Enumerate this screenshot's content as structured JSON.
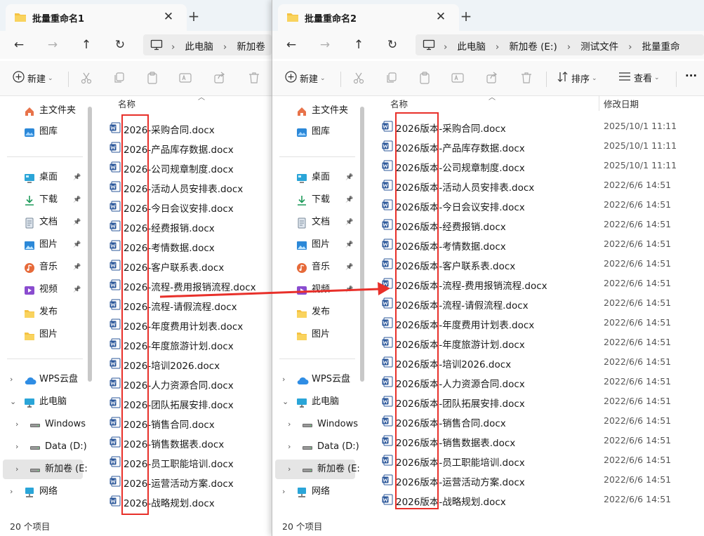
{
  "colors": {
    "accent": "#0067c0",
    "word_blue": "#2b579a",
    "highlight_red": "#e8302a",
    "folder_yellow": "#f5c242"
  },
  "window1": {
    "tab_title": "批量重命名1",
    "new_tab_label": "+",
    "breadcrumb": [
      "此电脑",
      "新加卷"
    ],
    "commands": {
      "new_label": "新建"
    },
    "sidebar": {
      "quick": [
        {
          "label": "主文件夹",
          "icon": "home-icon"
        },
        {
          "label": "图库",
          "icon": "gallery-icon"
        }
      ],
      "pinned": [
        {
          "label": "桌面",
          "icon": "desktop-icon"
        },
        {
          "label": "下载",
          "icon": "download-icon"
        },
        {
          "label": "文档",
          "icon": "document-icon"
        },
        {
          "label": "图片",
          "icon": "pictures-icon"
        },
        {
          "label": "音乐",
          "icon": "music-icon"
        },
        {
          "label": "视频",
          "icon": "video-icon"
        },
        {
          "label": "发布",
          "icon": "folder-icon"
        },
        {
          "label": "图片",
          "icon": "folder-icon"
        }
      ],
      "tree": [
        {
          "label": "WPS云盘",
          "icon": "cloud-icon"
        },
        {
          "label": "此电脑",
          "icon": "computer-icon"
        },
        {
          "label": "Windows",
          "icon": "drive-icon"
        },
        {
          "label": "Data (D:)",
          "icon": "drive-icon"
        },
        {
          "label": "新加卷 (E:",
          "icon": "drive-icon"
        },
        {
          "label": "网络",
          "icon": "network-icon"
        }
      ]
    },
    "column_name": "名称",
    "files": [
      "2026-采购合同.docx",
      "2026-产品库存数据.docx",
      "2026-公司规章制度.docx",
      "2026-活动人员安排表.docx",
      "2026-今日会议安排.docx",
      "2026-经费报销.docx",
      "2026-考情数据.docx",
      "2026-客户联系表.docx",
      "2026-流程-费用报销流程.docx",
      "2026-流程-请假流程.docx",
      "2026-年度费用计划表.docx",
      "2026-年度旅游计划.docx",
      "2026-培训2026.docx",
      "2026-人力资源合同.docx",
      "2026-团队拓展安排.docx",
      "2026-销售合同.docx",
      "2026-销售数据表.docx",
      "2026-员工职能培训.docx",
      "2026-运营活动方案.docx",
      "2026-战略规划.docx"
    ],
    "status": "20 个项目"
  },
  "window2": {
    "tab_title": "批量重命名2",
    "new_tab_label": "+",
    "breadcrumb": [
      "此电脑",
      "新加卷 (E:)",
      "测试文件",
      "批量重命"
    ],
    "commands": {
      "new_label": "新建",
      "sort_label": "排序",
      "view_label": "查看",
      "more_label": "···"
    },
    "sidebar": {
      "quick": [
        {
          "label": "主文件夹",
          "icon": "home-icon"
        },
        {
          "label": "图库",
          "icon": "gallery-icon"
        }
      ],
      "pinned": [
        {
          "label": "桌面",
          "icon": "desktop-icon"
        },
        {
          "label": "下载",
          "icon": "download-icon"
        },
        {
          "label": "文档",
          "icon": "document-icon"
        },
        {
          "label": "图片",
          "icon": "pictures-icon"
        },
        {
          "label": "音乐",
          "icon": "music-icon"
        },
        {
          "label": "视频",
          "icon": "video-icon"
        },
        {
          "label": "发布",
          "icon": "folder-icon"
        },
        {
          "label": "图片",
          "icon": "folder-icon"
        }
      ],
      "tree": [
        {
          "label": "WPS云盘",
          "icon": "cloud-icon"
        },
        {
          "label": "此电脑",
          "icon": "computer-icon"
        },
        {
          "label": "Windows",
          "icon": "drive-icon"
        },
        {
          "label": "Data (D:)",
          "icon": "drive-icon"
        },
        {
          "label": "新加卷 (E:",
          "icon": "drive-icon"
        },
        {
          "label": "网络",
          "icon": "network-icon"
        }
      ]
    },
    "column_name": "名称",
    "column_date": "修改日期",
    "files": [
      {
        "name": "2026版本-采购合同.docx",
        "date": "2025/10/1 11:11"
      },
      {
        "name": "2026版本-产品库存数据.docx",
        "date": "2025/10/1 11:11"
      },
      {
        "name": "2026版本-公司规章制度.docx",
        "date": "2025/10/1 11:11"
      },
      {
        "name": "2026版本-活动人员安排表.docx",
        "date": "2022/6/6 14:51"
      },
      {
        "name": "2026版本-今日会议安排.docx",
        "date": "2022/6/6 14:51"
      },
      {
        "name": "2026版本-经费报销.docx",
        "date": "2022/6/6 14:51"
      },
      {
        "name": "2026版本-考情数据.docx",
        "date": "2022/6/6 14:51"
      },
      {
        "name": "2026版本-客户联系表.docx",
        "date": "2022/6/6 14:51"
      },
      {
        "name": "2026版本-流程-费用报销流程.docx",
        "date": "2022/6/6 14:51"
      },
      {
        "name": "2026版本-流程-请假流程.docx",
        "date": "2022/6/6 14:51"
      },
      {
        "name": "2026版本-年度费用计划表.docx",
        "date": "2022/6/6 14:51"
      },
      {
        "name": "2026版本-年度旅游计划.docx",
        "date": "2022/6/6 14:51"
      },
      {
        "name": "2026版本-培训2026.docx",
        "date": "2022/6/6 14:51"
      },
      {
        "name": "2026版本-人力资源合同.docx",
        "date": "2022/6/6 14:51"
      },
      {
        "name": "2026版本-团队拓展安排.docx",
        "date": "2022/6/6 14:51"
      },
      {
        "name": "2026版本-销售合同.docx",
        "date": "2022/6/6 14:51"
      },
      {
        "name": "2026版本-销售数据表.docx",
        "date": "2022/6/6 14:51"
      },
      {
        "name": "2026版本-员工职能培训.docx",
        "date": "2022/6/6 14:51"
      },
      {
        "name": "2026版本-运营活动方案.docx",
        "date": "2022/6/6 14:51"
      },
      {
        "name": "2026版本-战略规划.docx",
        "date": "2022/6/6 14:51"
      }
    ],
    "status": "20 个项目"
  }
}
